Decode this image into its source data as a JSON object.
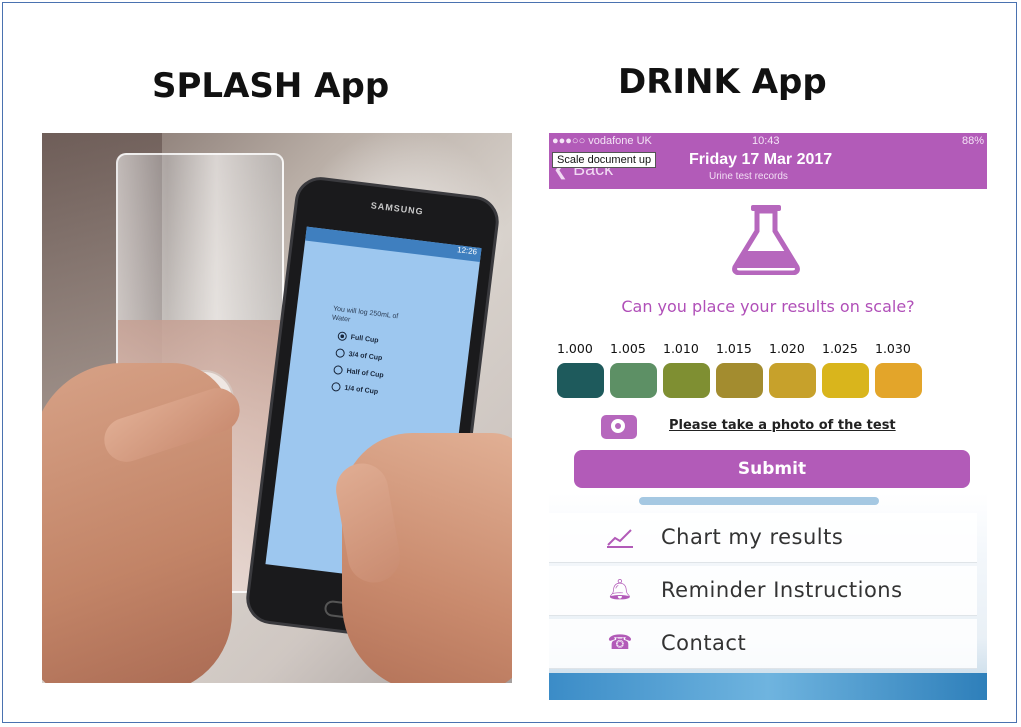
{
  "headings": {
    "left": "SPLASH App",
    "right": "DRINK App"
  },
  "splash_phone": {
    "brand": "SAMSUNG",
    "status": "12:26",
    "message": "You will log 250mL of Water",
    "options": [
      {
        "label": "Full Cup",
        "selected": true
      },
      {
        "label": "3/4 of Cup",
        "selected": false
      },
      {
        "label": "Half of Cup",
        "selected": false
      },
      {
        "label": "1/4 of Cup",
        "selected": false
      }
    ]
  },
  "drink": {
    "status": {
      "carrier": "●●●○○ vodafone UK ",
      "time": "10:43",
      "battery": "88%"
    },
    "back_label": "Back",
    "tooltip": "Scale document up",
    "title": "Friday 17 Mar 2017",
    "subtitle": "Urine test records",
    "question": "Can you place your results on scale?",
    "scale": [
      {
        "value": "1.000",
        "color": "#1e5a5c"
      },
      {
        "value": "1.005",
        "color": "#5d9065"
      },
      {
        "value": "1.010",
        "color": "#7f8f32"
      },
      {
        "value": "1.015",
        "color": "#a38c2f"
      },
      {
        "value": "1.020",
        "color": "#c7a12b"
      },
      {
        "value": "1.025",
        "color": "#d9b51c"
      },
      {
        "value": "1.030",
        "color": "#e3a52a"
      }
    ],
    "photo_link": "Please take a photo of the test",
    "submit_label": "Submit",
    "menu": [
      {
        "label": "Chart my results",
        "icon": "chart-icon"
      },
      {
        "label": "Reminder Instructions",
        "icon": "bell-icon"
      },
      {
        "label": "Contact",
        "icon": "phone-icon"
      }
    ],
    "accent": "#b25bb8"
  }
}
